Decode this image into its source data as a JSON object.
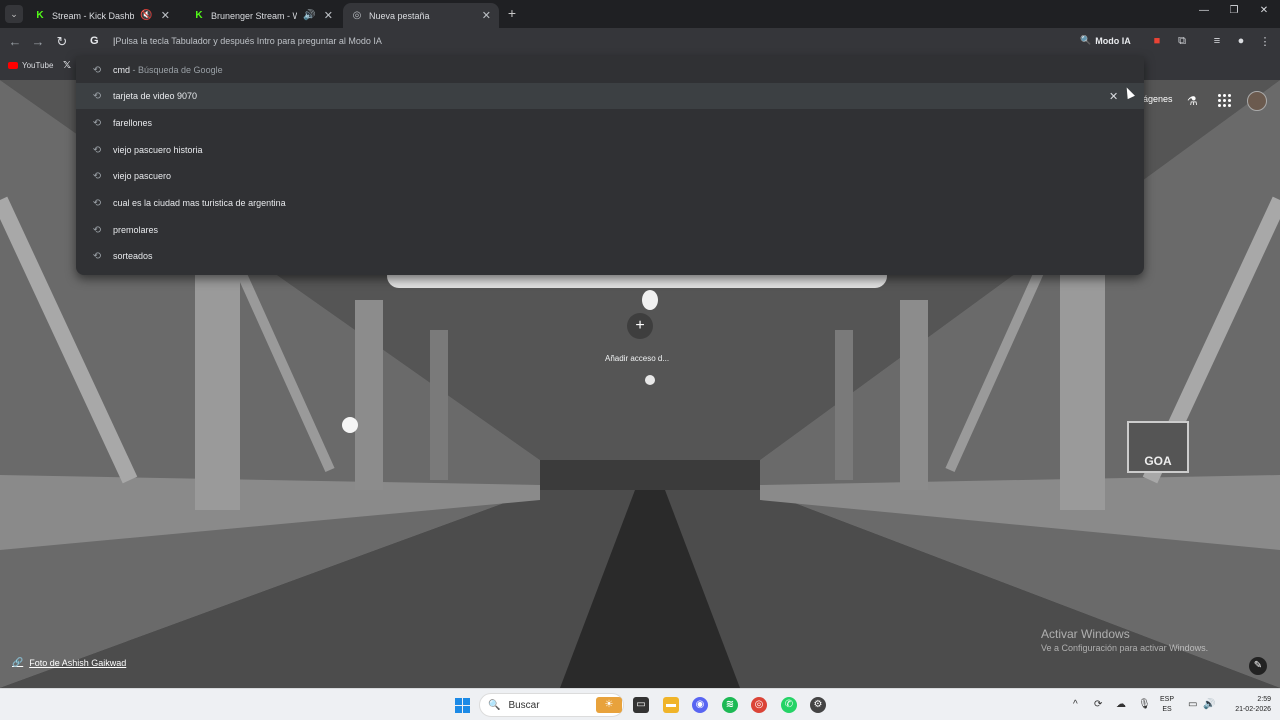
{
  "tabs": [
    {
      "title": "Stream - Kick Dashboard",
      "favicon": "kick-icon",
      "aux": "muted-icon"
    },
    {
      "title": "Brunenger Stream - Watch",
      "favicon": "kick-icon",
      "aux": "speaker-icon"
    },
    {
      "title": "Nueva pestaña",
      "favicon": "chrome-icon",
      "active": true
    }
  ],
  "omnibox": {
    "prefix": "G",
    "hint": "Pulsa la tecla Tabulador y después Intro para preguntar al Modo IA",
    "modo_ia": "Modo IA"
  },
  "bookmarks": [
    {
      "label": "YouTube",
      "icon": "youtube-icon"
    },
    {
      "label": "",
      "icon": "x-icon"
    }
  ],
  "suggestions": [
    {
      "text": "cmd",
      "sub": " - Búsqueda de Google",
      "icon": "history-icon"
    },
    {
      "text": "tarjeta de video 9070",
      "icon": "history-icon",
      "highlighted": true
    },
    {
      "text": "farellones",
      "icon": "history-icon"
    },
    {
      "text": "viejo pascuero historia",
      "icon": "history-icon"
    },
    {
      "text": "viejo pascuero",
      "icon": "history-icon"
    },
    {
      "text": "cual es la ciudad mas turistica de argentina",
      "icon": "history-icon"
    },
    {
      "text": "premolares",
      "icon": "history-icon"
    },
    {
      "text": "sorteados",
      "icon": "history-icon"
    }
  ],
  "page": {
    "images_link": "ágenes",
    "add_shortcut": "Añadir acceso d...",
    "photo_credit": "Foto de Ashish Gaikwad",
    "activate_title": "Activar Windows",
    "activate_sub": "Ve a Configuración para activar Windows."
  },
  "taskbar": {
    "search_placeholder": "Buscar",
    "lang_top": "ESP",
    "lang_bottom": "ES",
    "time": "2:59",
    "date": "21-02-2026"
  },
  "colors": {
    "kick_green": "#53fc18",
    "dropdown_bg": "#303134",
    "toolbar_bg": "#35363a",
    "windows_blue": "#1c8ae6"
  }
}
